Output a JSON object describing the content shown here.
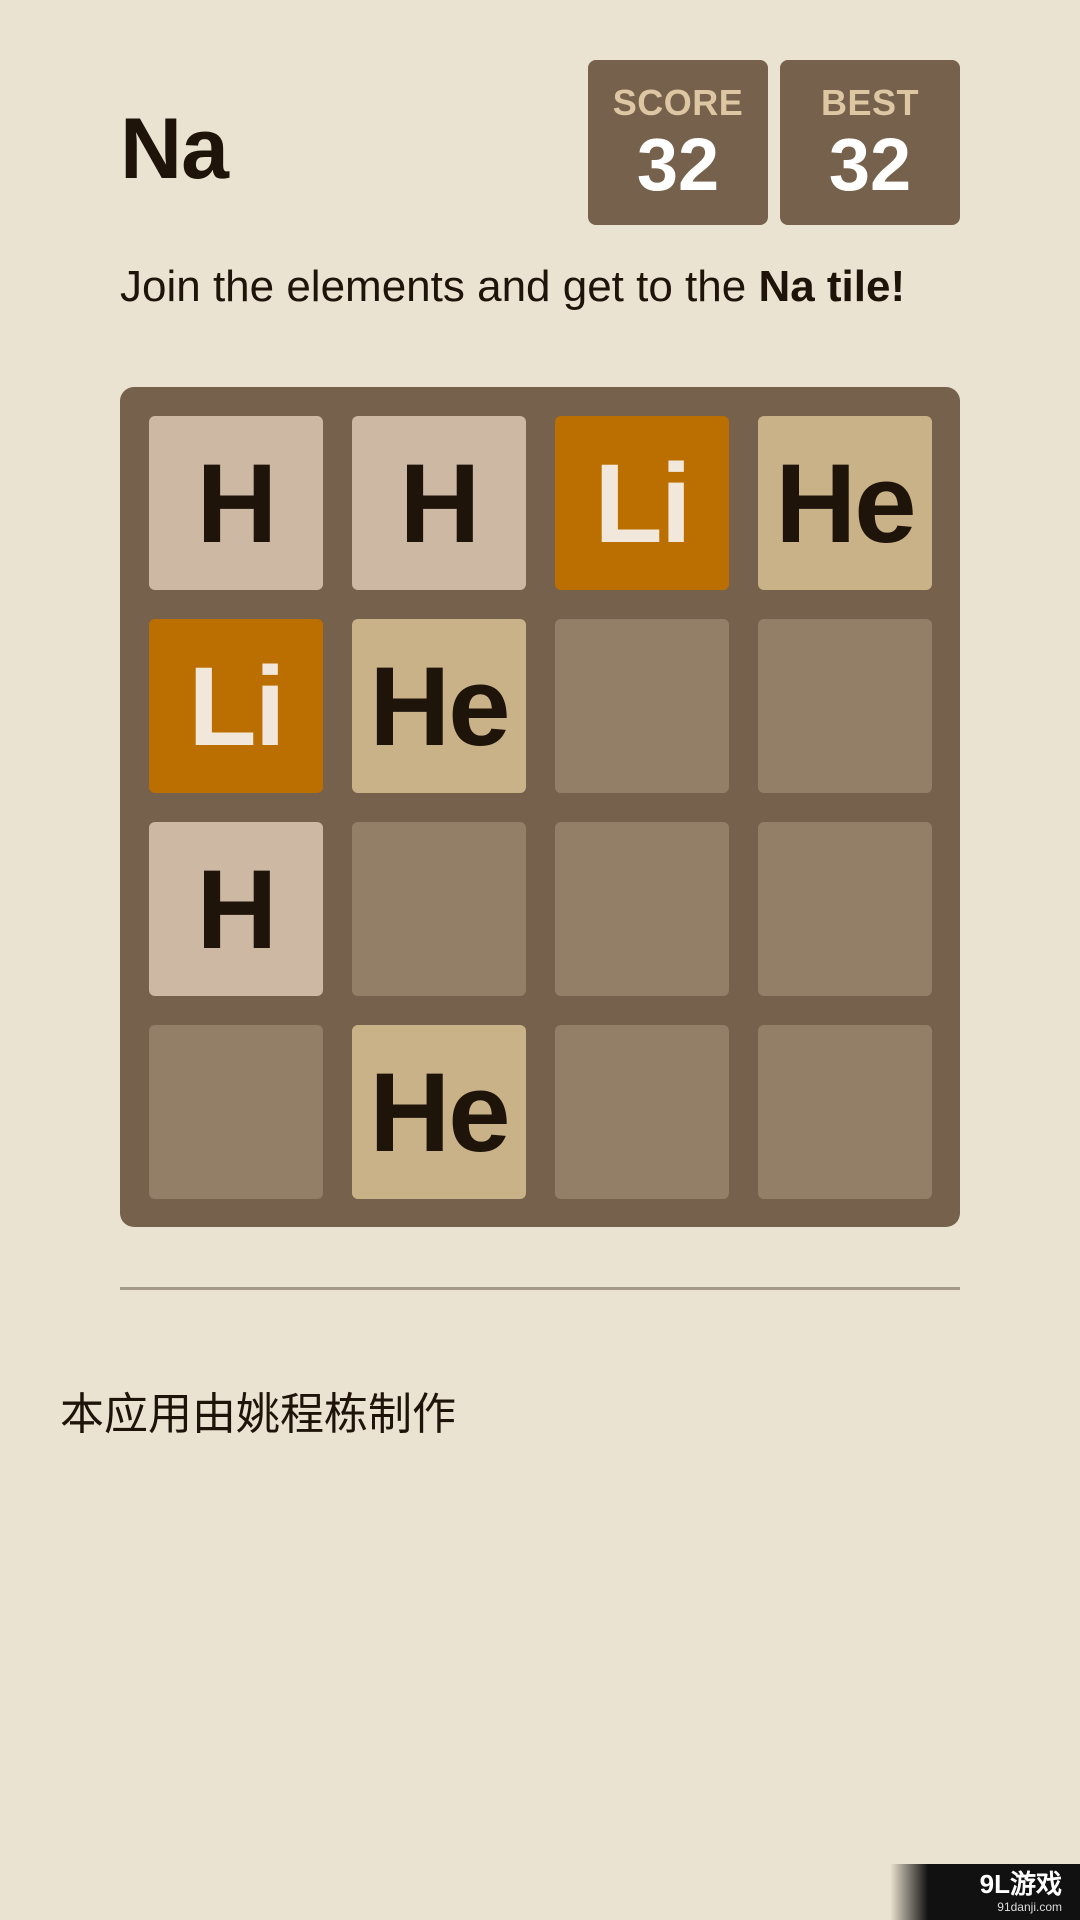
{
  "header": {
    "title": "Na",
    "score_label": "SCORE",
    "score_value": "32",
    "best_label": "BEST",
    "best_value": "32"
  },
  "subtitle": {
    "text": "Join the elements and get to the ",
    "bold": "Na tile!"
  },
  "board": {
    "rows": [
      [
        "H",
        "H",
        "Li",
        "He"
      ],
      [
        "Li",
        "He",
        "",
        ""
      ],
      [
        "H",
        "",
        "",
        ""
      ],
      [
        "",
        "He",
        "",
        ""
      ]
    ]
  },
  "footer": {
    "credit": "本应用由姚程栋制作"
  },
  "watermark": {
    "main": "9L游戏",
    "sub": "91danji.com"
  },
  "colors": {
    "background": "#ebe3d1",
    "board": "#76624c",
    "empty_cell": "#937f67",
    "tile_H": "#cdb8a4",
    "tile_He": "#c9b287",
    "tile_Li": "#bb6f00"
  }
}
